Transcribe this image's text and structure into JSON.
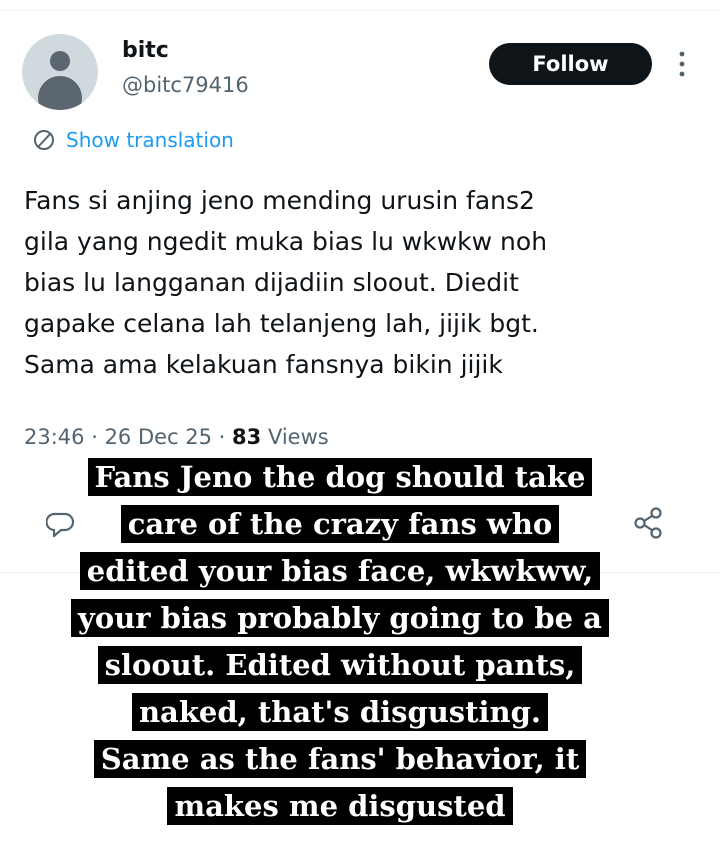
{
  "user": {
    "display_name": "bitc",
    "handle": "@bitc79416",
    "avatar_icon": "default-avatar-icon"
  },
  "actions": {
    "follow_label": "Follow",
    "more_icon": "more-vertical-icon"
  },
  "translation": {
    "label": "Show translation",
    "icon": "globe-icon"
  },
  "tweet": {
    "text": "Fans si anjing jeno mending urusin fans2\ngila yang ngedit muka bias lu wkwkw noh\nbias lu langganan dijadiin sloout. Diedit\ngapake celana lah telanjeng lah, jijik bgt.\nSama ama kelakuan fansnya bikin jijik",
    "time": "23:46",
    "separator": " · ",
    "date": "26 Dec 25",
    "views_count": "83",
    "views_label": " Views"
  },
  "engagement": {
    "reply_icon": "reply-icon",
    "share_icon": "share-icon"
  },
  "caption": {
    "lines": [
      "Fans Jeno the dog should take",
      "care of the crazy fans who",
      "edited your bias face, wkwkww,",
      "your bias probably going to be a",
      "sloout. Edited without pants,",
      "naked, that's disgusting.",
      "Same as the fans' behavior, it",
      "makes me disgusted"
    ]
  },
  "colors": {
    "accent": "#1d9bf0",
    "text_primary": "#0f1419",
    "text_secondary": "#536471",
    "caption_bg": "#000000",
    "caption_text": "#ffffff"
  }
}
